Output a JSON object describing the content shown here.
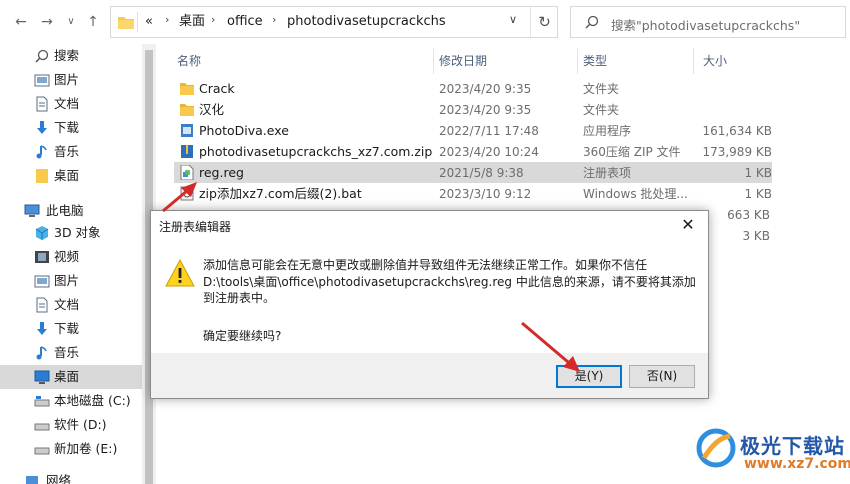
{
  "address": {
    "overflow": "«",
    "crumbs": [
      "桌面",
      "office",
      "photodivasetupcrackchs"
    ],
    "refresh_icon": "refresh-icon"
  },
  "search": {
    "placeholder": "搜索\"photodivasetupcrackchs\""
  },
  "sidebar": {
    "items": [
      {
        "label": "搜索",
        "icon": "search-icon"
      },
      {
        "label": "图片",
        "icon": "pictures-icon"
      },
      {
        "label": "文档",
        "icon": "documents-icon"
      },
      {
        "label": "下载",
        "icon": "download-icon"
      },
      {
        "label": "音乐",
        "icon": "music-icon"
      },
      {
        "label": "桌面",
        "icon": "desktop-folder-icon"
      },
      {
        "label": "此电脑",
        "icon": "computer-icon"
      },
      {
        "label": "3D 对象",
        "icon": "3d-objects-icon"
      },
      {
        "label": "视频",
        "icon": "video-icon"
      },
      {
        "label": "图片",
        "icon": "pictures-icon"
      },
      {
        "label": "文档",
        "icon": "documents-icon"
      },
      {
        "label": "下载",
        "icon": "download-icon"
      },
      {
        "label": "音乐",
        "icon": "music-icon"
      },
      {
        "label": "桌面",
        "icon": "desktop-icon"
      },
      {
        "label": "本地磁盘 (C:)",
        "icon": "drive-icon"
      },
      {
        "label": "软件 (D:)",
        "icon": "drive-icon"
      },
      {
        "label": "新加卷 (E:)",
        "icon": "drive-icon"
      },
      {
        "label": "网络",
        "icon": "network-icon"
      }
    ]
  },
  "columns": {
    "name": "名称",
    "date": "修改日期",
    "type": "类型",
    "size": "大小"
  },
  "files": [
    {
      "name": "Crack",
      "date": "2023/4/20 9:35",
      "type": "文件夹",
      "size": "",
      "icon": "folder-icon"
    },
    {
      "name": "汉化",
      "date": "2023/4/20 9:35",
      "type": "文件夹",
      "size": "",
      "icon": "folder-icon"
    },
    {
      "name": "PhotoDiva.exe",
      "date": "2022/7/11 17:48",
      "type": "应用程序",
      "size": "161,634 KB",
      "icon": "exe-icon"
    },
    {
      "name": "photodivasetupcrackchs_xz7.com.zip",
      "date": "2023/4/20 10:24",
      "type": "360压缩 ZIP 文件",
      "size": "173,989 KB",
      "icon": "zip-icon"
    },
    {
      "name": "reg.reg",
      "date": "2021/5/8 9:38",
      "type": "注册表项",
      "size": "1 KB",
      "icon": "registry-file-icon"
    },
    {
      "name": "zip添加xz7.com后缀(2).bat",
      "date": "2023/3/10 9:12",
      "type": "Windows 批处理...",
      "size": "1 KB",
      "icon": "bat-icon"
    }
  ],
  "hidden_sizes": [
    "663 KB",
    "3 KB"
  ],
  "dialog": {
    "title": "注册表编辑器",
    "message": "添加信息可能会在无意中更改或删除值并导致组件无法继续正常工作。如果你不信任 D:\\tools\\桌面\\office\\photodivasetupcrackchs\\reg.reg 中此信息的来源，请不要将其添加到注册表中。",
    "question": "确定要继续吗?",
    "yes_label": "是(Y)",
    "no_label": "否(N)",
    "close": "✕"
  },
  "watermark": {
    "brand": "极光下载站",
    "url": "www.xz7.com"
  },
  "colors": {
    "accent": "#0078d7",
    "arrow": "#d42a2a",
    "selection": "#d9d9d9",
    "folder": "#f8c94a"
  }
}
